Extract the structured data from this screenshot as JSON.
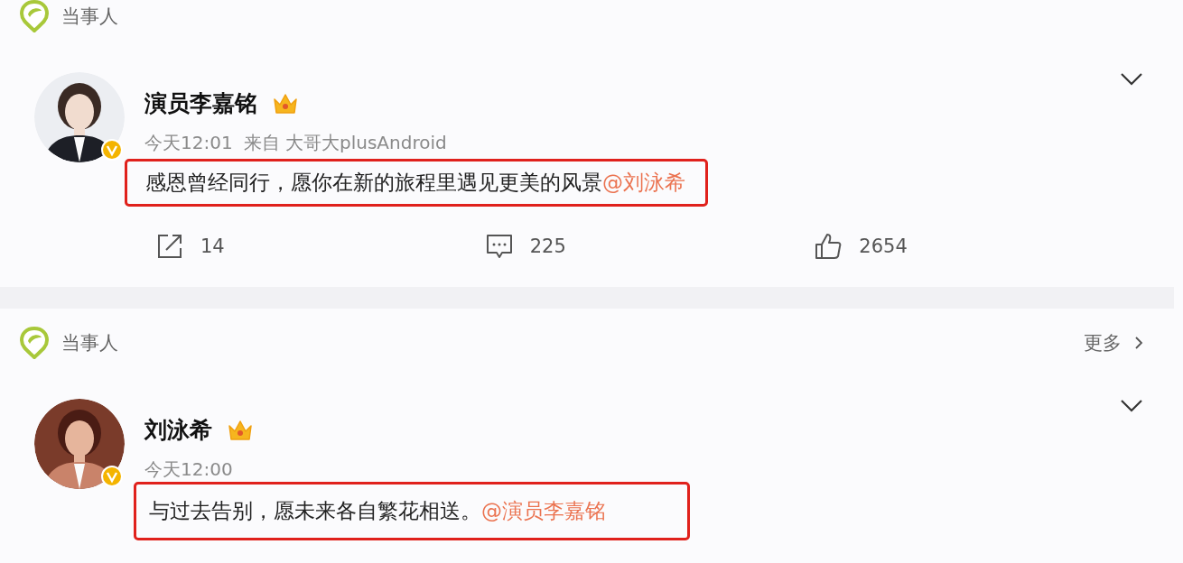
{
  "posts": [
    {
      "section_label": "当事人",
      "author": "演员李嘉铭",
      "time": "今天12:01",
      "source": "来自 大哥大plusAndroid",
      "text": "感恩曾经同行，愿你在新的旅程里遇见更美的风景",
      "mention": "@刘泳希",
      "highlighted": true,
      "actions": [
        {
          "kind": "share",
          "count": "14"
        },
        {
          "kind": "comment",
          "count": "225"
        },
        {
          "kind": "like",
          "count": "2654"
        }
      ]
    },
    {
      "section_label": "当事人",
      "more_link": "更多",
      "author": "刘泳希",
      "time": "今天12:00",
      "text": "与过去告别，愿未来各自繁花相送。",
      "mention": "@演员李嘉铭",
      "highlighted": true
    }
  ]
}
